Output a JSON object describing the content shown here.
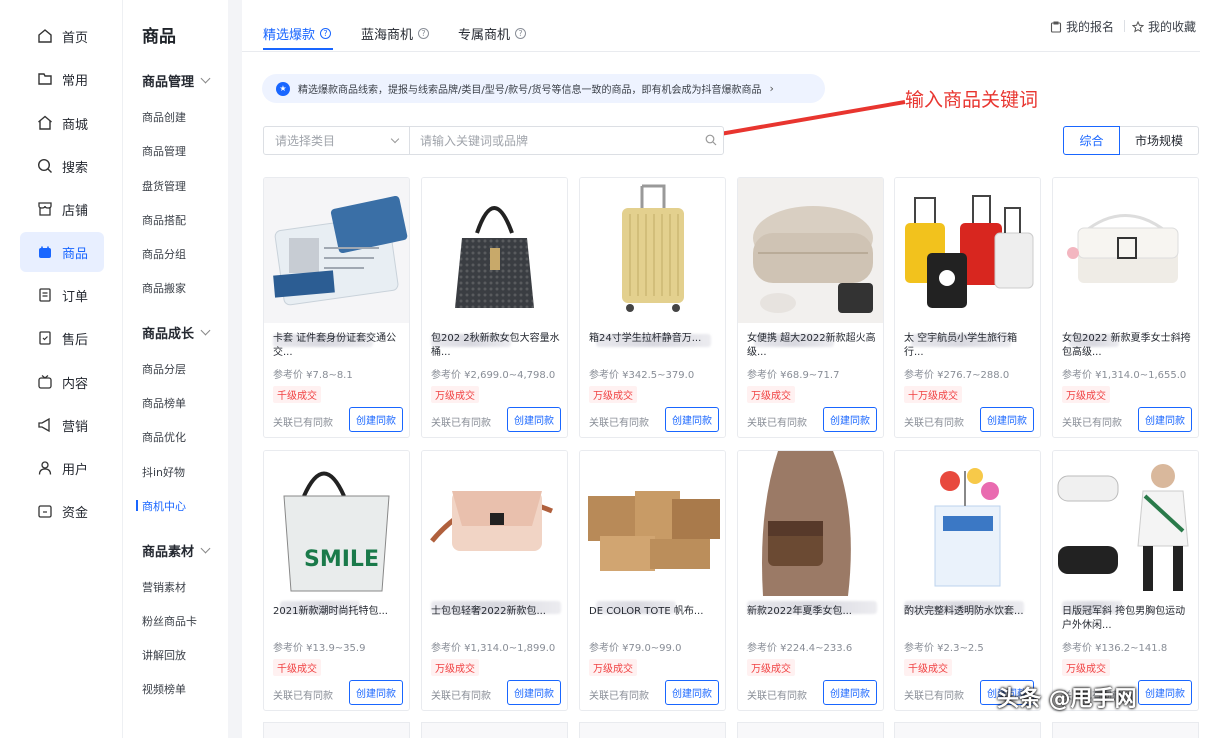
{
  "rail": {
    "items": [
      {
        "label": "首页",
        "icon": "home-icon"
      },
      {
        "label": "常用",
        "icon": "folder-icon"
      },
      {
        "label": "商城",
        "icon": "house-icon"
      },
      {
        "label": "搜索",
        "icon": "search-chart-icon"
      },
      {
        "label": "店铺",
        "icon": "store-icon"
      },
      {
        "label": "商品",
        "icon": "bag-icon"
      },
      {
        "label": "订单",
        "icon": "order-icon"
      },
      {
        "label": "售后",
        "icon": "aftersale-icon"
      },
      {
        "label": "内容",
        "icon": "tv-icon"
      },
      {
        "label": "营销",
        "icon": "megaphone-icon"
      },
      {
        "label": "用户",
        "icon": "user-icon"
      },
      {
        "label": "资金",
        "icon": "wallet-icon"
      }
    ],
    "active": "商品"
  },
  "submenu": {
    "title": "商品",
    "groups": [
      {
        "label": "商品管理",
        "items": [
          "商品创建",
          "商品管理",
          "盘货管理",
          "商品搭配",
          "商品分组",
          "商品搬家"
        ]
      },
      {
        "label": "商品成长",
        "items": [
          "商品分层",
          "商品榜单",
          "商品优化",
          "抖in好物",
          "商机中心"
        ]
      },
      {
        "label": "商品素材",
        "items": [
          "营销素材",
          "粉丝商品卡",
          "讲解回放",
          "视频榜单"
        ]
      }
    ],
    "active_item": "商机中心"
  },
  "tabs": [
    {
      "label": "精选爆款",
      "active": true
    },
    {
      "label": "蓝海商机",
      "active": false
    },
    {
      "label": "专属商机",
      "active": false
    }
  ],
  "toplinks": {
    "signup": "我的报名",
    "favorites": "我的收藏"
  },
  "notice": {
    "text": "精选爆款商品线索，提报与线索品牌/类目/型号/款号/货号等信息一致的商品，即有机会成为抖音爆款商品"
  },
  "annotation": "输入商品关键词",
  "filters": {
    "category_placeholder": "请选择类目",
    "keyword_placeholder": "请输入关键词或品牌",
    "sort": [
      {
        "label": "综合",
        "active": true
      },
      {
        "label": "市场规模",
        "active": false
      }
    ]
  },
  "card_labels": {
    "related": "关联已有同款",
    "create": "创建同款"
  },
  "products": [
    {
      "name": "卡套 证件套身份证套交通公交...",
      "price": "参考价 ¥7.8~8.1",
      "badge": "千级成交",
      "image": "card-holder"
    },
    {
      "name": "包202 2秋新款女包大容量水桶...",
      "price": "参考价 ¥2,699.0~4,798.0",
      "badge": "万级成交",
      "image": "black-bucket-bag"
    },
    {
      "name": "箱24寸学生拉杆静音万...",
      "price": "参考价 ¥342.5~379.0",
      "badge": "万级成交",
      "image": "yellow-suitcase"
    },
    {
      "name": "女便携 超大2022新款超火高级...",
      "price": "参考价 ¥68.9~71.7",
      "badge": "万级成交",
      "image": "cosmetic-bag"
    },
    {
      "name": "太 空宇航员小学生旅行箱行...",
      "price": "参考价 ¥276.7~288.0",
      "badge": "十万级成交",
      "image": "kids-suitcases"
    },
    {
      "name": "女包2022 新款夏季女士斜挎包高级...",
      "price": "参考价 ¥1,314.0~1,655.0",
      "badge": "万级成交",
      "image": "white-shoulder-bag"
    },
    {
      "name": "2021新款潮时尚托特包...",
      "price": "参考价 ¥13.9~35.9",
      "badge": "千级成交",
      "image": "tote-smile"
    },
    {
      "name": "士包包轻奢2022新款包...",
      "price": "参考价 ¥1,314.0~1,899.0",
      "badge": "万级成交",
      "image": "pink-crossbody"
    },
    {
      "name": "DE COLOR TOTE 帆布...",
      "price": "参考价 ¥79.0~99.0",
      "badge": "万级成交",
      "image": "canvas-totes"
    },
    {
      "name": "新款2022年夏季女包...",
      "price": "参考价 ¥224.4~233.6",
      "badge": "万级成交",
      "image": "monogram-bag"
    },
    {
      "name": "酌状完整料透明防水饮套...",
      "price": "参考价 ¥2.3~2.5",
      "badge": "千级成交",
      "image": "clear-bag"
    },
    {
      "name": "日版冠军斜 挎包男胸包运动户外休闲...",
      "price": "参考价 ¥136.2~141.8",
      "badge": "万级成交",
      "image": "waist-bag"
    }
  ],
  "watermark": "头条 @甩手网"
}
